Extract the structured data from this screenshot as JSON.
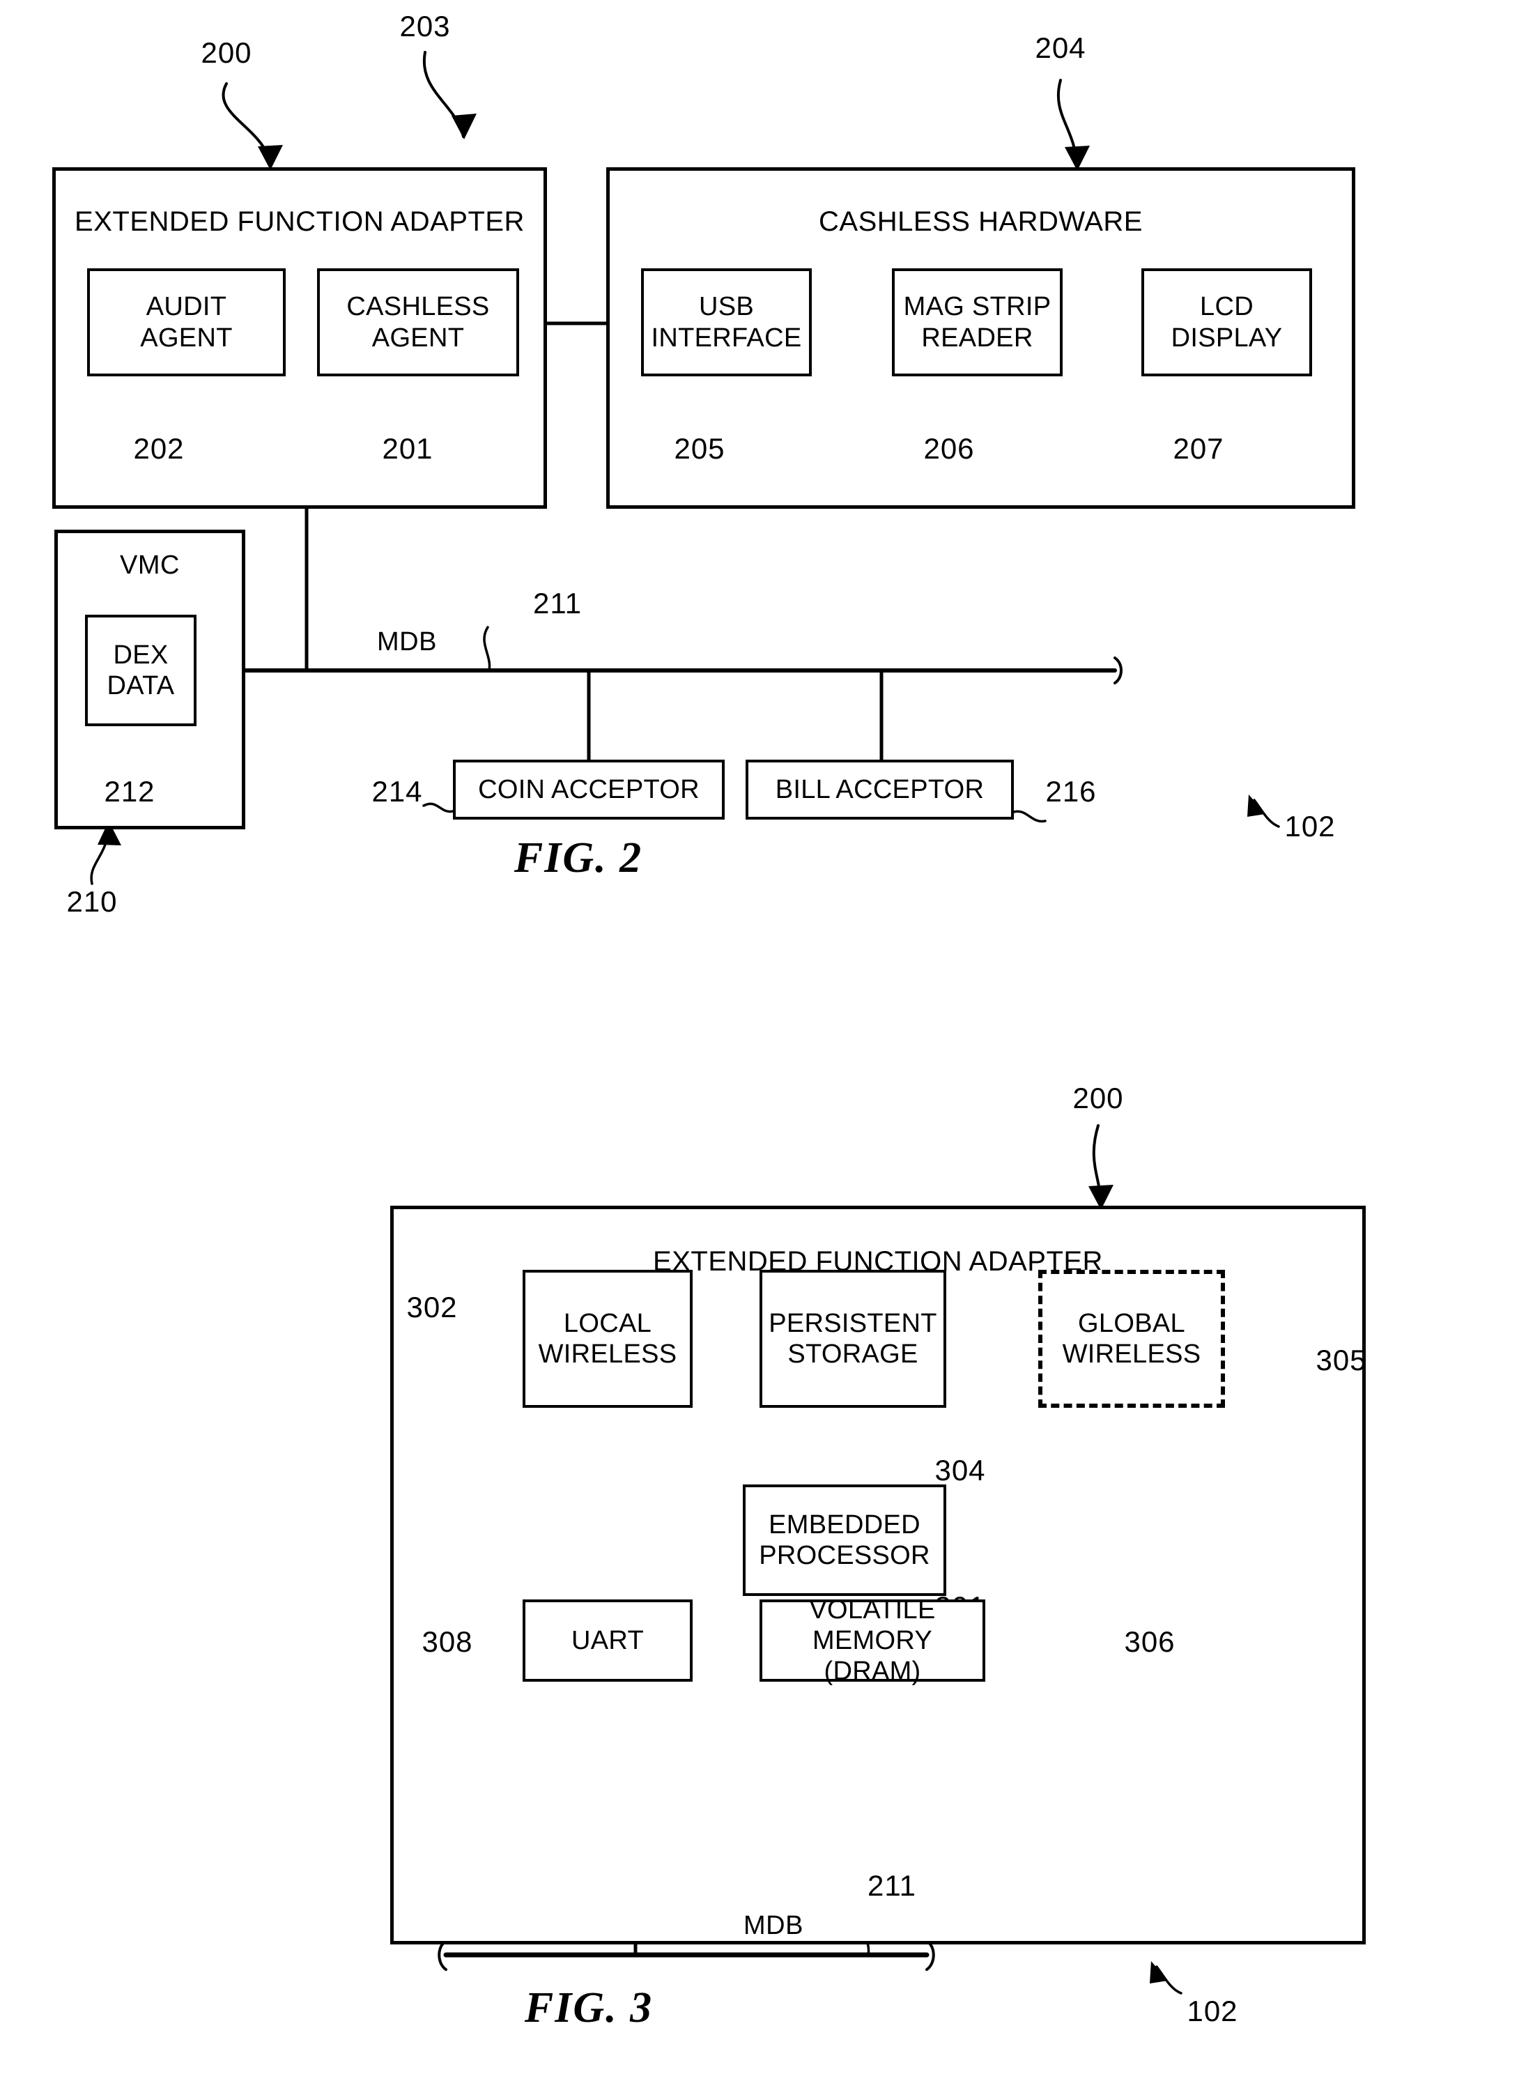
{
  "figures": [
    {
      "id": "fig2",
      "caption": "FIG. 2",
      "system_ref": "102",
      "blocks": {
        "extended_function_adapter": {
          "title": "EXTENDED FUNCTION ADAPTER",
          "ref": "200",
          "children": [
            {
              "label": "AUDIT AGENT",
              "line1": "AUDIT",
              "line2": "AGENT",
              "ref": "202"
            },
            {
              "label": "CASHLESS AGENT",
              "line1": "CASHLESS",
              "line2": "AGENT",
              "ref": "201"
            }
          ]
        },
        "cashless_hardware": {
          "title": "CASHLESS HARDWARE",
          "ref": "204",
          "children": [
            {
              "label": "USB INTERFACE",
              "line1": "USB",
              "line2": "INTERFACE",
              "ref": "205"
            },
            {
              "label": "MAG STRIP READER",
              "line1": "MAG STRIP",
              "line2": "READER",
              "ref": "206"
            },
            {
              "label": "LCD DISPLAY",
              "line1": "LCD",
              "line2": "DISPLAY",
              "ref": "207"
            }
          ]
        },
        "vmc": {
          "title": "VMC",
          "ref": "210",
          "children": [
            {
              "label": "DEX DATA",
              "line1": "DEX",
              "line2": "DATA",
              "ref": "212"
            }
          ]
        },
        "coin_acceptor": {
          "label": "COIN ACCEPTOR",
          "ref": "214"
        },
        "bill_acceptor": {
          "label": "BILL ACCEPTOR",
          "ref": "216"
        }
      },
      "buses": [
        {
          "name": "MDB",
          "ref": "211"
        }
      ],
      "link_ref": "203"
    },
    {
      "id": "fig3",
      "caption": "FIG. 3",
      "system_ref": "102",
      "blocks": {
        "extended_function_adapter": {
          "title": "EXTENDED FUNCTION ADAPTER",
          "ref": "200",
          "children": [
            {
              "label": "LOCAL WIRELESS",
              "line1": "LOCAL",
              "line2": "WIRELESS",
              "ref": "302",
              "style": "solid"
            },
            {
              "label": "PERSISTENT STORAGE",
              "line1": "PERSISTENT",
              "line2": "STORAGE",
              "ref": "304",
              "style": "solid"
            },
            {
              "label": "GLOBAL WIRELESS",
              "line1": "GLOBAL",
              "line2": "WIRELESS",
              "ref": "305",
              "style": "dashed"
            },
            {
              "label": "EMBEDDED PROCESSOR",
              "line1": "EMBEDDED",
              "line2": "PROCESSOR",
              "ref": "301",
              "style": "solid"
            },
            {
              "label": "UART",
              "line1": "UART",
              "line2": "",
              "ref": "308",
              "style": "solid"
            },
            {
              "label": "VOLATILE MEMORY (DRAM)",
              "line1": "VOLATILE",
              "line2": "MEMORY (DRAM)",
              "ref": "306",
              "style": "solid"
            }
          ]
        }
      },
      "buses": [
        {
          "name": "MDB",
          "ref": "211"
        }
      ]
    }
  ],
  "colors": {
    "ink": "#000000",
    "paper": "#ffffff"
  }
}
